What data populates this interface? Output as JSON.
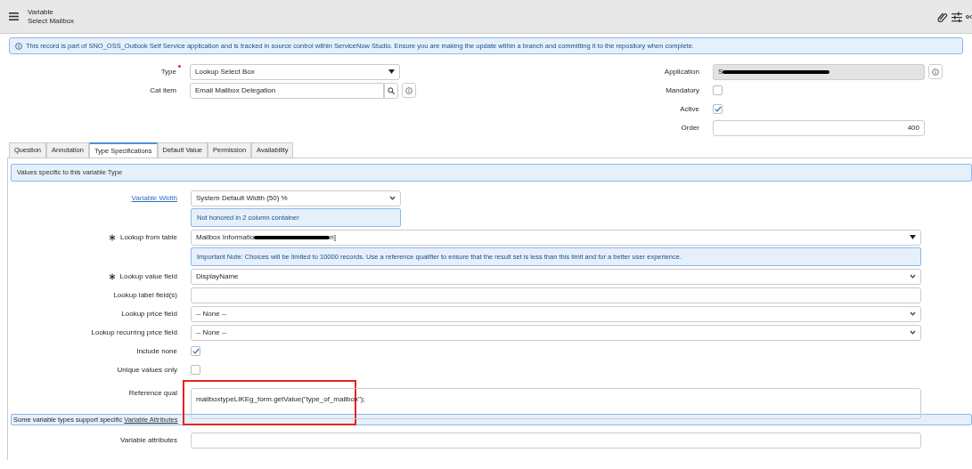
{
  "header": {
    "record_type": "Variable",
    "record_name": "Select Mailbox"
  },
  "info_banner": "This record is part of SNO_OSS_Outlook Self Service application and is tracked in source control within ServiceNow Studio. Ensure you are making the update within a branch and committing it to the repository when complete.",
  "left_fields": [
    {
      "label": "Type",
      "kind": "dropdown",
      "value": "Lookup Select Box",
      "required": true
    },
    {
      "label": "Cat item",
      "kind": "reference",
      "value": "Email Mailbox Delegation"
    }
  ],
  "right_fields": [
    {
      "label": "Application",
      "kind": "readonly",
      "value": "S",
      "redacted": true
    },
    {
      "label": "Mandatory",
      "kind": "checkbox",
      "checked": false
    },
    {
      "label": "Active",
      "kind": "checkbox",
      "checked": true
    },
    {
      "label": "Order",
      "kind": "number",
      "value": "400"
    }
  ],
  "tabs": [
    {
      "label": "Question",
      "selected": false
    },
    {
      "label": "Annotation",
      "selected": false
    },
    {
      "label": "Type Specifications",
      "selected": true
    },
    {
      "label": "Default Value",
      "selected": false
    },
    {
      "label": "Permission",
      "selected": false
    },
    {
      "label": "Availability",
      "selected": false
    }
  ],
  "section_banner": "Values specific to this variable Type",
  "spec_rows": [
    {
      "kind": "select",
      "label": "Variable Width",
      "label_link": true,
      "value": "System Default Width (50) %",
      "narrow": true
    },
    {
      "kind": "note",
      "text": "Not honored in 2 column container",
      "narrow": true
    },
    {
      "kind": "dropdown",
      "label": "Lookup from table",
      "value": "Mailbox Informatio",
      "redacted": true,
      "value_end": "n]",
      "required": true
    },
    {
      "kind": "note",
      "text": "Important Note: Choices will be limited to 10000 records. Use a reference qualifier to ensure that the result set is less than this limit and for a better user experience.",
      "narrow": false
    },
    {
      "kind": "select",
      "label": "Lookup value field",
      "value": "DisplayName",
      "required": true
    },
    {
      "kind": "text",
      "label": "Lookup label field(s)"
    },
    {
      "kind": "select",
      "label": "Lookup price field",
      "value": "-- None --"
    },
    {
      "kind": "select",
      "label": "Lookup recurring price field",
      "value": "-- None --"
    },
    {
      "kind": "checkbox",
      "label": "Include none",
      "checked": true
    },
    {
      "kind": "checkbox",
      "label": "Unique values only",
      "checked": false
    },
    {
      "kind": "textarea",
      "label": "Reference qual",
      "value": "mailboxtypeLIKEg_form.getValue(\"type_of_mailbox\");",
      "highlighted": true
    }
  ],
  "attributes_banner": {
    "text": "Some variable types support specific",
    "link": "Variable Attributes"
  },
  "attribute_rows": [
    {
      "kind": "text",
      "label": "Variable attributes"
    }
  ]
}
